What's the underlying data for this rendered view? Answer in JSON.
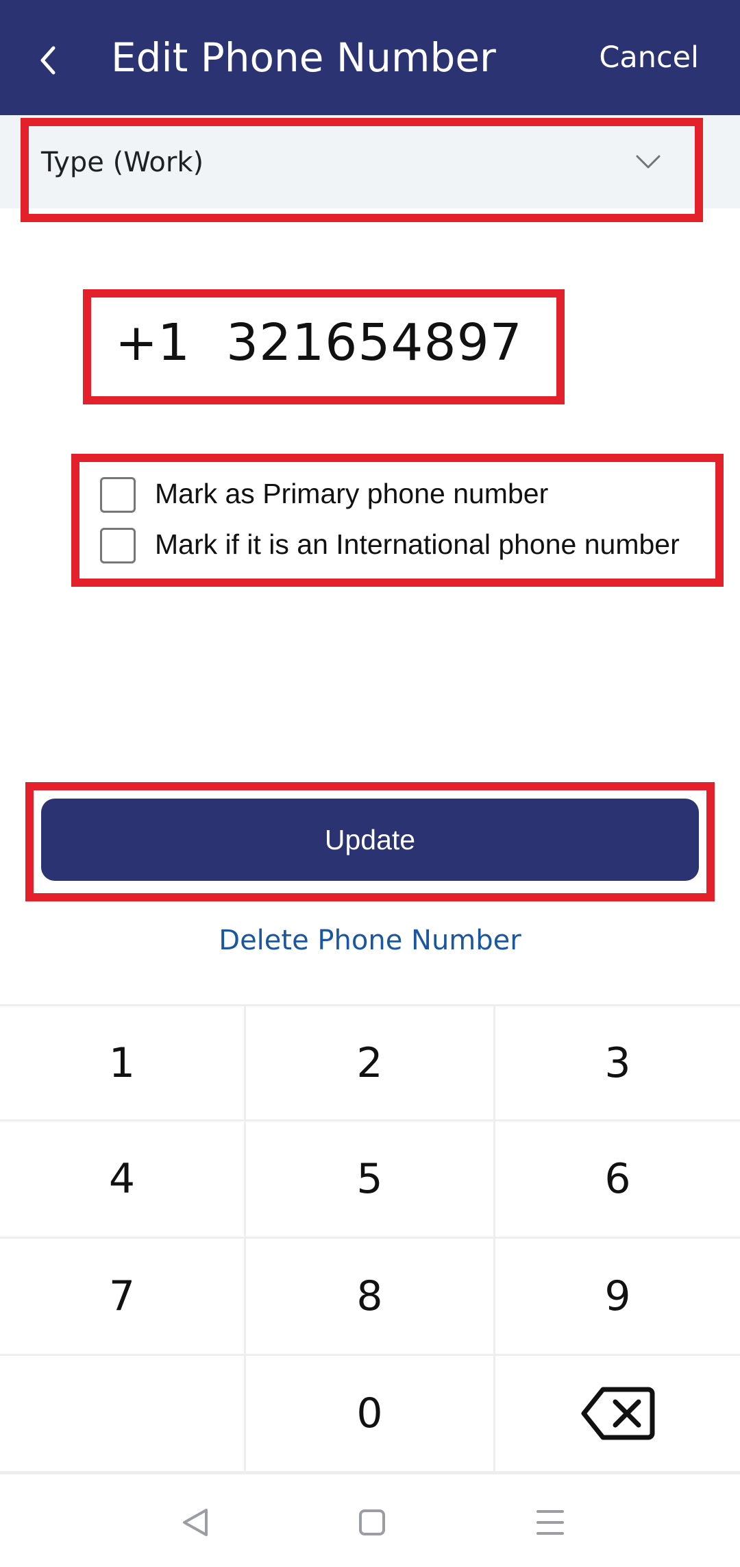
{
  "header": {
    "back_icon": "chevron-left-icon",
    "title": "Edit Phone Number",
    "cancel_label": "Cancel",
    "background": "#2c3373"
  },
  "type_selector": {
    "label": "Type (Work)",
    "icon": "chevron-down-icon"
  },
  "phone": {
    "country_code": "+1",
    "number": "321654897"
  },
  "options": [
    {
      "label": "Mark as Primary phone number",
      "checked": false
    },
    {
      "label": "Mark if it is an International phone number",
      "checked": false
    }
  ],
  "actions": {
    "update_label": "Update",
    "delete_label": "Delete Phone Number"
  },
  "keypad": {
    "keys": [
      "1",
      "2",
      "3",
      "4",
      "5",
      "6",
      "7",
      "8",
      "9",
      "",
      "0",
      "backspace-icon"
    ]
  },
  "nav": {
    "icons": [
      "nav-back-icon",
      "nav-home-icon",
      "nav-menu-icon"
    ]
  },
  "colors": {
    "primary": "#2c3373",
    "link": "#1b56a0",
    "highlight": "#e4202b"
  }
}
